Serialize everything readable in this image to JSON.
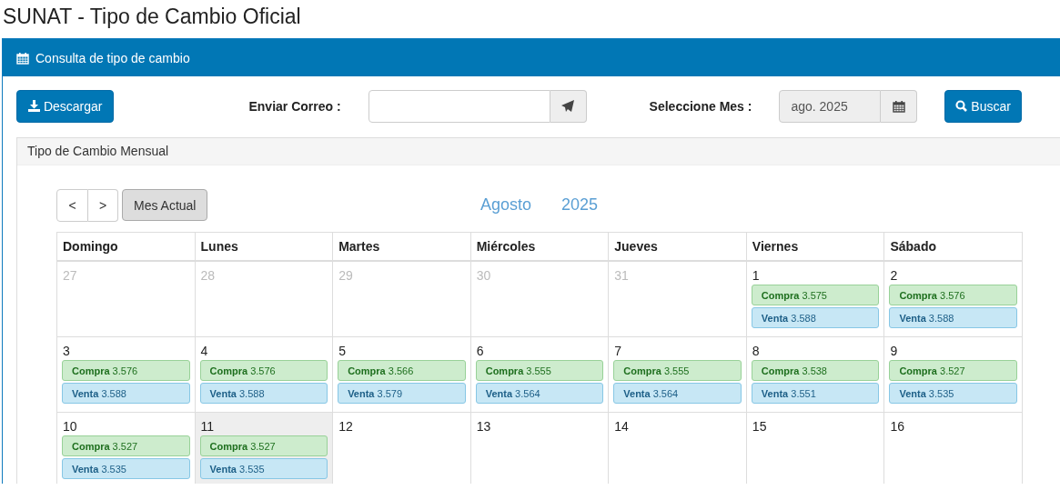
{
  "page_title": "SUNAT - Tipo de Cambio Oficial",
  "panel": {
    "title": "Consulta de tipo de cambio"
  },
  "toolbar": {
    "download_button": "Descargar",
    "email_label": "Enviar Correo :",
    "month_label": "Seleccione Mes :",
    "month_field": {
      "value": "ago. 2025"
    },
    "search_button": "Buscar"
  },
  "monthly": {
    "title": "Tipo de Cambio Mensual",
    "nav": {
      "prev": "<",
      "next": ">",
      "current": "Mes Actual"
    },
    "month": "Agosto",
    "year": "2025",
    "weekdays": [
      "Domingo",
      "Lunes",
      "Martes",
      "Miércoles",
      "Jueves",
      "Viernes",
      "Sábado"
    ],
    "weeks": [
      [
        {
          "day": "27",
          "other_month": true,
          "today": false
        },
        {
          "day": "28",
          "other_month": true,
          "today": false
        },
        {
          "day": "29",
          "other_month": true,
          "today": false
        },
        {
          "day": "30",
          "other_month": true,
          "today": false
        },
        {
          "day": "31",
          "other_month": true,
          "today": false
        },
        {
          "day": "1",
          "other_month": false,
          "today": false,
          "rates": [
            {
              "kind": "compra",
              "text": "**Compra** 3.575"
            },
            {
              "kind": "venta",
              "text": "**Venta** 3.588"
            }
          ]
        },
        {
          "day": "2",
          "other_month": false,
          "today": false,
          "rates": [
            {
              "kind": "compra",
              "text": "**Compra** 3.576"
            },
            {
              "kind": "venta",
              "text": "**Venta** 3.588"
            }
          ]
        }
      ],
      [
        {
          "day": "3",
          "other_month": false,
          "today": false,
          "rates": [
            {
              "kind": "compra",
              "text": "**Compra** 3.576"
            },
            {
              "kind": "venta",
              "text": "**Venta** 3.588"
            }
          ]
        },
        {
          "day": "4",
          "other_month": false,
          "today": false,
          "rates": [
            {
              "kind": "compra",
              "text": "**Compra** 3.576"
            },
            {
              "kind": "venta",
              "text": "**Venta** 3.588"
            }
          ]
        },
        {
          "day": "5",
          "other_month": false,
          "today": false,
          "rates": [
            {
              "kind": "compra",
              "text": "**Compra** 3.566"
            },
            {
              "kind": "venta",
              "text": "**Venta** 3.579"
            }
          ]
        },
        {
          "day": "6",
          "other_month": false,
          "today": false,
          "rates": [
            {
              "kind": "compra",
              "text": "**Compra** 3.555"
            },
            {
              "kind": "venta",
              "text": "**Venta** 3.564"
            }
          ]
        },
        {
          "day": "7",
          "other_month": false,
          "today": false,
          "rates": [
            {
              "kind": "compra",
              "text": "**Compra** 3.555"
            },
            {
              "kind": "venta",
              "text": "**Venta** 3.564"
            }
          ]
        },
        {
          "day": "8",
          "other_month": false,
          "today": false,
          "rates": [
            {
              "kind": "compra",
              "text": "**Compra** 3.538"
            },
            {
              "kind": "venta",
              "text": "**Venta** 3.551"
            }
          ]
        },
        {
          "day": "9",
          "other_month": false,
          "today": false,
          "rates": [
            {
              "kind": "compra",
              "text": "**Compra** 3.527"
            },
            {
              "kind": "venta",
              "text": "**Venta** 3.535"
            }
          ]
        }
      ],
      [
        {
          "day": "10",
          "other_month": false,
          "today": false,
          "rates": [
            {
              "kind": "compra",
              "text": "**Compra** 3.527"
            },
            {
              "kind": "venta",
              "text": "**Venta** 3.535"
            }
          ]
        },
        {
          "day": "11",
          "other_month": false,
          "today": true,
          "rates": [
            {
              "kind": "compra",
              "text": "**Compra** 3.527"
            },
            {
              "kind": "venta",
              "text": "**Venta** 3.535"
            }
          ]
        },
        {
          "day": "12",
          "other_month": false,
          "today": false
        },
        {
          "day": "13",
          "other_month": false,
          "today": false
        },
        {
          "day": "14",
          "other_month": false,
          "today": false
        },
        {
          "day": "15",
          "other_month": false,
          "today": false
        },
        {
          "day": "16",
          "other_month": false,
          "today": false
        }
      ]
    ]
  }
}
